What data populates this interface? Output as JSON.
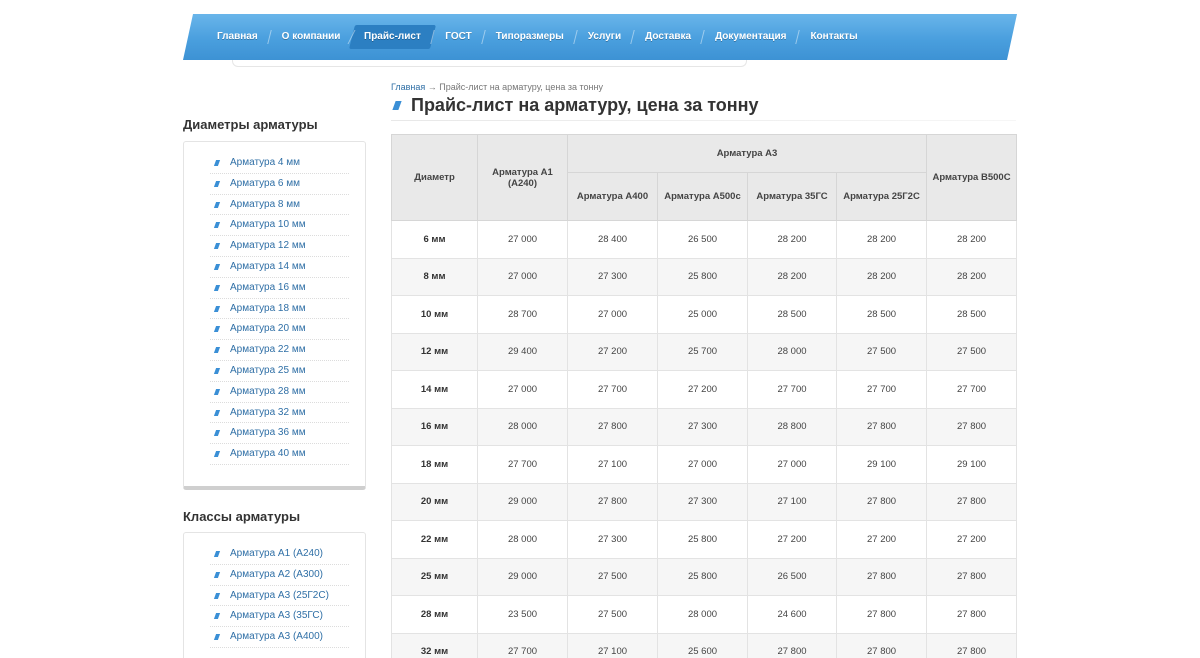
{
  "nav": {
    "items": [
      {
        "label": "Главная",
        "active": false
      },
      {
        "label": "О компании",
        "active": false
      },
      {
        "label": "Прайс-лист",
        "active": true
      },
      {
        "label": "ГОСТ",
        "active": false
      },
      {
        "label": "Типоразмеры",
        "active": false
      },
      {
        "label": "Услуги",
        "active": false
      },
      {
        "label": "Доставка",
        "active": false
      },
      {
        "label": "Документация",
        "active": false
      },
      {
        "label": "Контакты",
        "active": false
      }
    ]
  },
  "breadcrumb": {
    "home": "Главная",
    "separator": "→",
    "current": "Прайс-лист на арматуру, цена за тонну"
  },
  "page_title": "Прайс-лист на арматуру, цена за тонну",
  "sidebar": {
    "diameters": {
      "title": "Диаметры арматуры",
      "items": [
        "Арматура 4 мм",
        "Арматура 6 мм",
        "Арматура 8 мм",
        "Арматура 10 мм",
        "Арматура 12 мм",
        "Арматура 14 мм",
        "Арматура 16 мм",
        "Арматура 18 мм",
        "Арматура 20 мм",
        "Арматура 22 мм",
        "Арматура 25 мм",
        "Арматура 28 мм",
        "Арматура 32 мм",
        "Арматура 36 мм",
        "Арматура 40 мм"
      ]
    },
    "classes": {
      "title": "Классы арматуры",
      "items": [
        "Арматура А1 (А240)",
        "Арматура А2 (А300)",
        "Арматура А3 (25Г2С)",
        "Арматура А3 (35ГС)",
        "Арматура А3 (А400)"
      ]
    }
  },
  "table": {
    "headers": {
      "diameter": "Диаметр",
      "a1": "Арматура А1 (А240)",
      "a3_group": "Арматура А3",
      "a3_sub": [
        "Арматура А400",
        "Арматура А500с",
        "Арматура 35ГС",
        "Арматура 25Г2С"
      ],
      "b500": "Арматура В500С"
    },
    "rows": [
      [
        "6 мм",
        "27 000",
        "28 400",
        "26 500",
        "28 200",
        "28 200",
        "28 200"
      ],
      [
        "8 мм",
        "27 000",
        "27 300",
        "25 800",
        "28 200",
        "28 200",
        "28 200"
      ],
      [
        "10 мм",
        "28 700",
        "27 000",
        "25 000",
        "28 500",
        "28 500",
        "28 500"
      ],
      [
        "12 мм",
        "29 400",
        "27 200",
        "25 700",
        "28 000",
        "27 500",
        "27 500"
      ],
      [
        "14 мм",
        "27 000",
        "27 700",
        "27 200",
        "27 700",
        "27 700",
        "27 700"
      ],
      [
        "16 мм",
        "28 000",
        "27 800",
        "27 300",
        "28 800",
        "27 800",
        "27 800"
      ],
      [
        "18 мм",
        "27 700",
        "27 100",
        "27 000",
        "27 000",
        "29 100",
        "29 100"
      ],
      [
        "20 мм",
        "29 000",
        "27 800",
        "27 300",
        "27 100",
        "27 800",
        "27 800"
      ],
      [
        "22 мм",
        "28 000",
        "27 300",
        "25 800",
        "27 200",
        "27 200",
        "27 200"
      ],
      [
        "25 мм",
        "29 000",
        "27 500",
        "25 800",
        "26 500",
        "27 800",
        "27 800"
      ],
      [
        "28 мм",
        "23 500",
        "27 500",
        "28 000",
        "24 600",
        "27 800",
        "27 800"
      ],
      [
        "32 мм",
        "27 700",
        "27 100",
        "25 600",
        "27 800",
        "27 800",
        "27 800"
      ]
    ]
  },
  "colors": {
    "nav_blue": "#4a9fde",
    "nav_active": "#2c7fc2",
    "link_blue": "#2f6fa6",
    "header_gray": "#e9e9e9"
  }
}
